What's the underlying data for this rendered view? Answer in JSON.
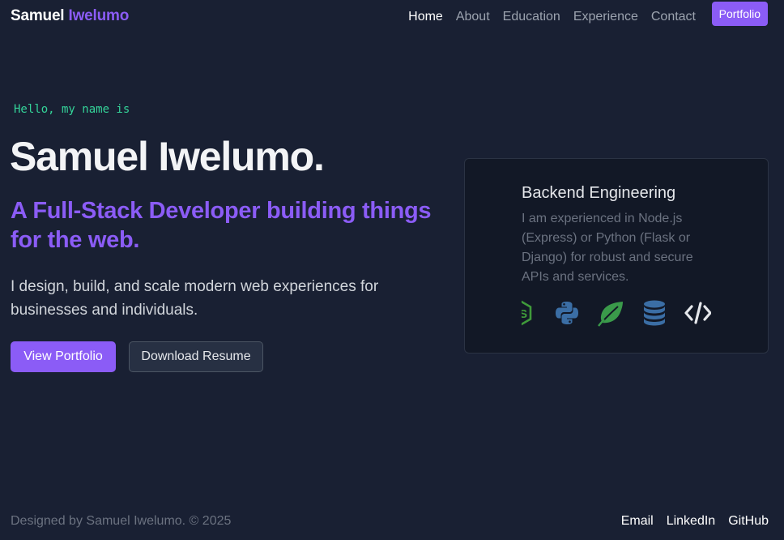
{
  "brand": {
    "first": "Samuel",
    "last": "Iwelumo"
  },
  "nav": {
    "links": [
      {
        "label": "Home",
        "active": true
      },
      {
        "label": "About"
      },
      {
        "label": "Education"
      },
      {
        "label": "Experience"
      },
      {
        "label": "Contact"
      }
    ],
    "cta_label": "Portfolio"
  },
  "hero": {
    "greeting": "Hello, my name is",
    "name": "Samuel Iwelumo.",
    "tagline": "A Full-Stack Developer building things for the web.",
    "description": "I design, build, and scale modern web experiences for businesses and individuals.",
    "primary_button": "View Portfolio",
    "secondary_button": "Download Resume"
  },
  "card": {
    "title": "Backend Engineering",
    "text": "I am experienced in Node.js (Express) or Python (Flask or Django) for robust and secure APIs and services.",
    "icons": [
      "nodejs-icon",
      "python-icon",
      "mongodb-leaf-icon",
      "database-icon",
      "code-icon"
    ]
  },
  "footer": {
    "copyright": "Designed by Samuel Iwelumo. © 2025",
    "links": [
      "Email",
      "LinkedIn",
      "GitHub"
    ]
  },
  "colors": {
    "background": "#192033",
    "accent": "#8b5cf6",
    "greeting": "#34d399",
    "card_background": "#121826"
  }
}
